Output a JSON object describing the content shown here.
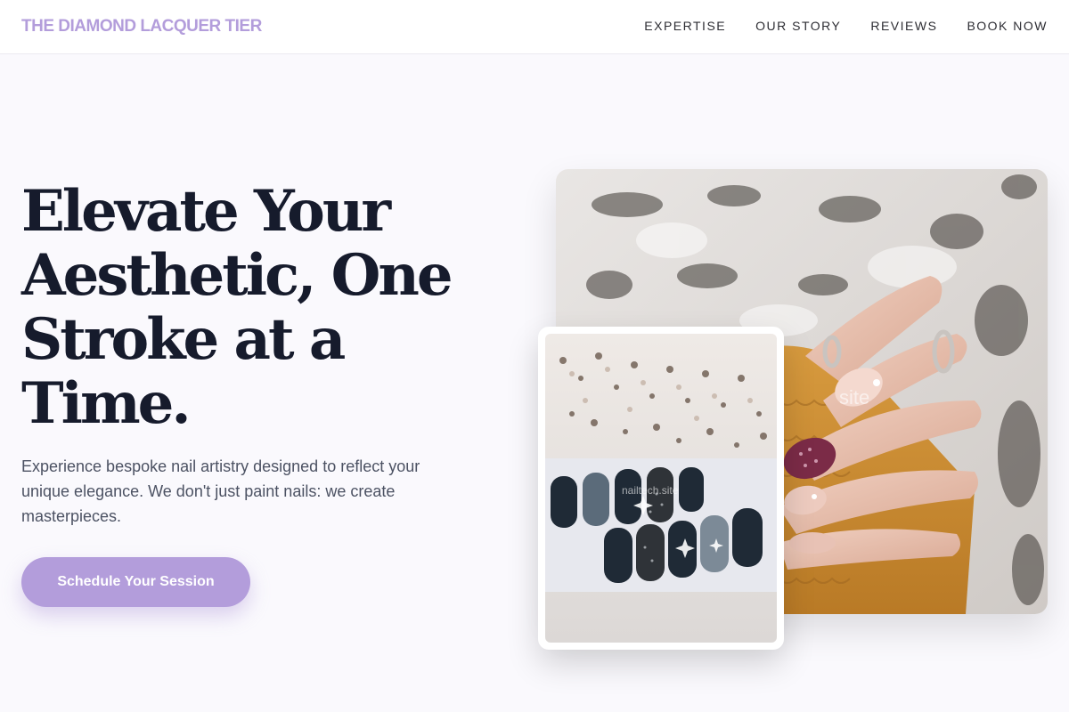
{
  "brand": "THE DIAMOND LACQUER TIER",
  "nav": {
    "items": [
      {
        "label": "EXPERTISE"
      },
      {
        "label": "OUR STORY"
      },
      {
        "label": "REVIEWS"
      },
      {
        "label": "BOOK NOW"
      }
    ]
  },
  "hero": {
    "headline": "Elevate Your Aesthetic, One Stroke at a Time.",
    "subtext": "Experience bespoke nail artistry designed to reflect your unique elegance. We don't just paint nails: we create masterpieces.",
    "cta_label": "Schedule Your Session"
  },
  "images": {
    "main_watermark": "site",
    "inset_watermark": "nailtech.site"
  },
  "colors": {
    "accent": "#b39ddb",
    "headline": "#161b2c",
    "body_text": "#4c5263",
    "background": "#faf9fd"
  }
}
